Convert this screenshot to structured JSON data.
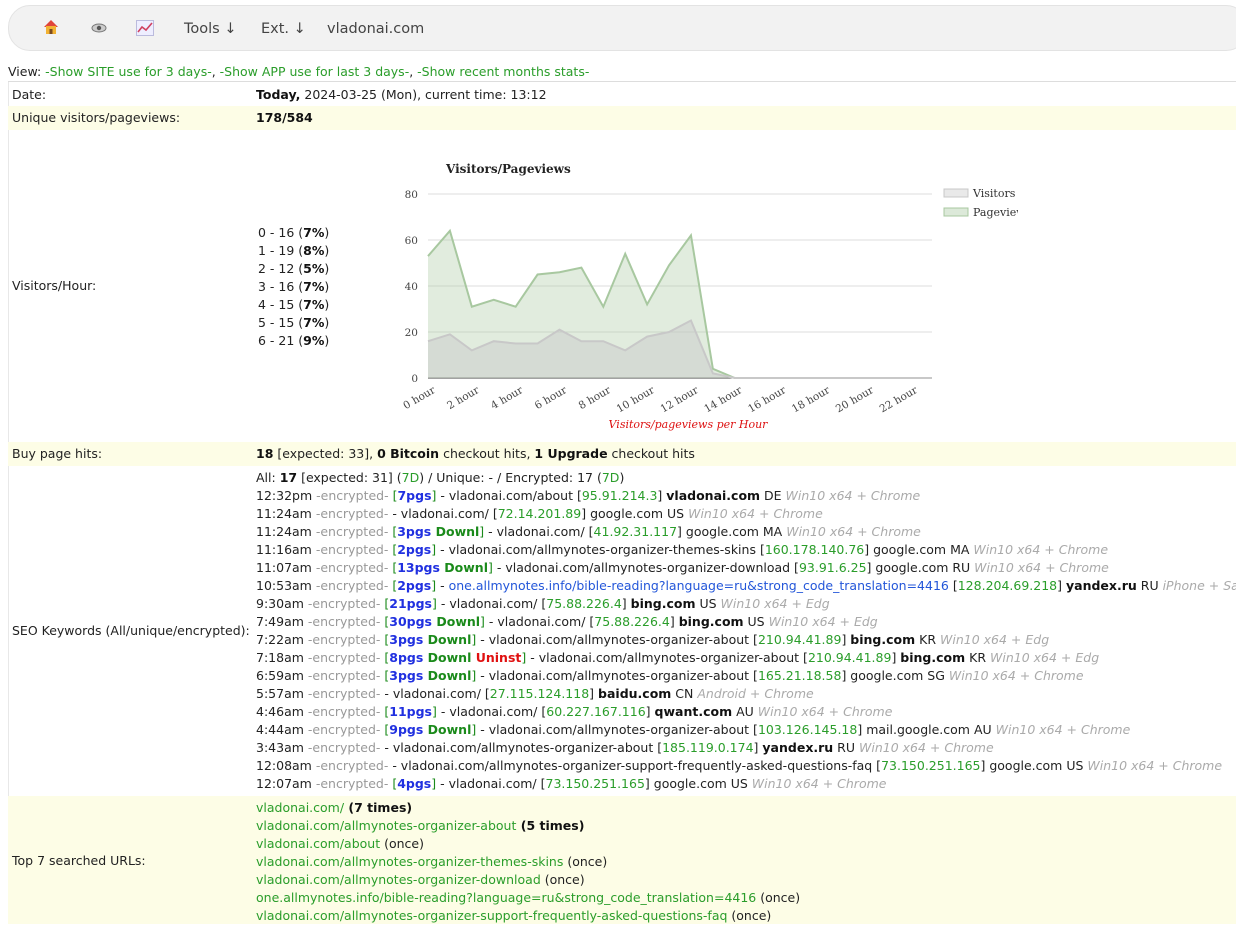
{
  "nav": {
    "home_icon": "home-icon",
    "eye_icon": "eye-icon",
    "chart_icon": "chart-icon",
    "tools": "Tools ↓",
    "ext": "Ext. ↓",
    "site": "vladonai.com"
  },
  "view": {
    "label": "View: ",
    "link1": "-Show SITE use for 3 days-",
    "sep1": ", ",
    "link2": "-Show APP use for last 3 days-",
    "sep2": ", ",
    "link3": "-Show recent months stats-"
  },
  "date": {
    "label": "Date:",
    "today": "Today,",
    "rest": " 2024-03-25 (Mon), current time: 13:12"
  },
  "unique": {
    "label": "Unique visitors/pageviews:",
    "value": "178/584"
  },
  "hours": {
    "label": "Visitors/Hour:",
    "items": [
      {
        "a": "0 - 16 (",
        "b": "7%",
        "c": ")"
      },
      {
        "a": "1 - 19 (",
        "b": "8%",
        "c": ")"
      },
      {
        "a": "2 - 12 (",
        "b": "5%",
        "c": ")"
      },
      {
        "a": "3 - 16 (",
        "b": "7%",
        "c": ")"
      },
      {
        "a": "4 - 15 (",
        "b": "7%",
        "c": ")"
      },
      {
        "a": "5 - 15 (",
        "b": "7%",
        "c": ")"
      },
      {
        "a": "6 - 21 (",
        "b": "9%",
        "c": ")"
      }
    ]
  },
  "chart_data": {
    "type": "area",
    "title": "Visitors/Pageviews",
    "xlabel": "Visitors/pageviews per Hour",
    "ylabel": "",
    "ylim": [
      0,
      80
    ],
    "yticks": [
      "0",
      "20",
      "40",
      "60",
      "80"
    ],
    "x": [
      0,
      1,
      2,
      3,
      4,
      5,
      6,
      7,
      8,
      9,
      10,
      11,
      12,
      13,
      14,
      15,
      16,
      17,
      18,
      19,
      20,
      21,
      22,
      23
    ],
    "xtick_labels": [
      "0 hour",
      "2 hour",
      "4 hour",
      "6 hour",
      "8 hour",
      "10 hour",
      "12 hour",
      "14 hour",
      "16 hour",
      "18 hour",
      "20 hour",
      "22 hour"
    ],
    "series": [
      {
        "name": "Visitors",
        "color": "#c8c8c8",
        "values": [
          16,
          19,
          12,
          16,
          15,
          15,
          21,
          16,
          16,
          12,
          18,
          20,
          25,
          2,
          0,
          0,
          0,
          0,
          0,
          0,
          0,
          0,
          0,
          0
        ]
      },
      {
        "name": "Pageviews",
        "color": "#a8c8a0",
        "values": [
          53,
          64,
          31,
          34,
          31,
          45,
          46,
          48,
          31,
          54,
          32,
          49,
          62,
          4,
          0,
          0,
          0,
          0,
          0,
          0,
          0,
          0,
          0,
          0
        ]
      }
    ],
    "legend": "top-right",
    "grid": true
  },
  "buy": {
    "label": "Buy page hits:",
    "n1": "18",
    "t1": " [expected: 33], ",
    "n2": "0 Bitcoin",
    "t2": " checkout hits, ",
    "n3": "1 Upgrade",
    "t3": " checkout hits"
  },
  "seo": {
    "label": "SEO Keywords (All/unique/encrypted):",
    "summary_a": "All: ",
    "summary_b": "17",
    "summary_c": " [expected: 31] (",
    "summary_d": "7D",
    "summary_e": ") / Unique: - / Encrypted: 17 (",
    "summary_f": "7D",
    "summary_g": ")",
    "entries": [
      {
        "time": "12:32pm",
        "enc": " -encrypted- ",
        "b1": "[",
        "pg": "7pgs",
        "dl": "",
        "un": "",
        "b2": "]",
        " url": "",
        "u": " - vladonai.com/about [",
        "ip": "95.91.214.3",
        "after": "] ",
        "eng": "vladonai.com",
        "engb": true,
        "cc": " DE ",
        "ua": "Win10 x64 + Chrome"
      },
      {
        "time": "11:24am",
        "enc": " -encrypted- ",
        "b1": "",
        "pg": "",
        "dl": "",
        "un": "",
        "b2": "",
        "u": " - vladonai.com/ [",
        "ip": "72.14.201.89",
        "after": "] ",
        "eng": "google.com",
        "engb": false,
        "cc": " US ",
        "ua": "Win10 x64 + Chrome"
      },
      {
        "time": "11:24am",
        "enc": " -encrypted- ",
        "b1": "[",
        "pg": "3pgs",
        "dl": " Downl",
        "un": "",
        "b2": "]",
        "u": " - vladonai.com/ [",
        "ip": "41.92.31.117",
        "after": "] ",
        "eng": "google.com",
        "engb": false,
        "cc": " MA ",
        "ua": "Win10 x64 + Chrome"
      },
      {
        "time": "11:16am",
        "enc": " -encrypted- ",
        "b1": "[",
        "pg": "2pgs",
        "dl": "",
        "un": "",
        "b2": "]",
        "u": " - vladonai.com/allmynotes-organizer-themes-skins [",
        "ip": "160.178.140.76",
        "after": "] ",
        "eng": "google.com",
        "engb": false,
        "cc": " MA ",
        "ua": "Win10 x64 + Chrome"
      },
      {
        "time": "11:07am",
        "enc": " -encrypted- ",
        "b1": "[",
        "pg": "13pgs",
        "dl": " Downl",
        "un": "",
        "b2": "]",
        "u": " - vladonai.com/allmynotes-organizer-download [",
        "ip": "93.91.6.25",
        "after": "] ",
        "eng": "google.com",
        "engb": false,
        "cc": " RU ",
        "ua": "Win10 x64 + Chrome"
      },
      {
        "time": "10:53am",
        "enc": " -encrypted- ",
        "b1": "[",
        "pg": "2pgs",
        "dl": "",
        "un": "",
        "b2": "]",
        "u": " - ",
        "link": "one.allmynotes.info/bible-reading?language=ru&strong_code_translation=4416",
        "u2": " [",
        "ip": "128.204.69.218",
        "after": "] ",
        "eng": "yandex.ru",
        "engb": true,
        "cc": " RU ",
        "ua": "iPhone + Safari"
      },
      {
        "time": "9:30am",
        "enc": " -encrypted- ",
        "b1": "[",
        "pg": "21pgs",
        "dl": "",
        "un": "",
        "b2": "]",
        "u": " - vladonai.com/ [",
        "ip": "75.88.226.4",
        "after": "] ",
        "eng": "bing.com",
        "engb": true,
        "cc": " US ",
        "ua": "Win10 x64 + Edg"
      },
      {
        "time": "7:49am",
        "enc": " -encrypted- ",
        "b1": "[",
        "pg": "30pgs",
        "dl": " Downl",
        "un": "",
        "b2": "]",
        "u": " - vladonai.com/ [",
        "ip": "75.88.226.4",
        "after": "] ",
        "eng": "bing.com",
        "engb": true,
        "cc": " US ",
        "ua": "Win10 x64 + Edg"
      },
      {
        "time": "7:22am",
        "enc": " -encrypted- ",
        "b1": "[",
        "pg": "3pgs",
        "dl": " Downl",
        "un": "",
        "b2": "]",
        "u": " - vladonai.com/allmynotes-organizer-about [",
        "ip": "210.94.41.89",
        "after": "] ",
        "eng": "bing.com",
        "engb": true,
        "cc": " KR ",
        "ua": "Win10 x64 + Edg"
      },
      {
        "time": "7:18am",
        "enc": " -encrypted- ",
        "b1": "[",
        "pg": "8pgs",
        "dl": " Downl",
        "un": " Uninst",
        "b2": "]",
        "u": " - vladonai.com/allmynotes-organizer-about [",
        "ip": "210.94.41.89",
        "after": "] ",
        "eng": "bing.com",
        "engb": true,
        "cc": " KR ",
        "ua": "Win10 x64 + Edg"
      },
      {
        "time": "6:59am",
        "enc": " -encrypted- ",
        "b1": "[",
        "pg": "3pgs",
        "dl": " Downl",
        "un": "",
        "b2": "]",
        "u": " - vladonai.com/allmynotes-organizer-about [",
        "ip": "165.21.18.58",
        "after": "] ",
        "eng": "google.com",
        "engb": false,
        "cc": " SG ",
        "ua": "Win10 x64 + Chrome"
      },
      {
        "time": "5:57am",
        "enc": " -encrypted- ",
        "b1": "",
        "pg": "",
        "dl": "",
        "un": "",
        "b2": "",
        "u": " - vladonai.com/ [",
        "ip": "27.115.124.118",
        "after": "] ",
        "eng": "baidu.com",
        "engb": true,
        "cc": " CN ",
        "ua": "Android + Chrome"
      },
      {
        "time": "4:46am",
        "enc": " -encrypted- ",
        "b1": "[",
        "pg": "11pgs",
        "dl": "",
        "un": "",
        "b2": "]",
        "u": " - vladonai.com/ [",
        "ip": "60.227.167.116",
        "after": "] ",
        "eng": "qwant.com",
        "engb": true,
        "cc": " AU ",
        "ua": "Win10 x64 + Chrome"
      },
      {
        "time": "4:44am",
        "enc": " -encrypted- ",
        "b1": "[",
        "pg": "9pgs",
        "dl": " Downl",
        "un": "",
        "b2": "]",
        "u": " - vladonai.com/allmynotes-organizer-about [",
        "ip": "103.126.145.18",
        "after": "] ",
        "eng": "mail.google.com",
        "engb": false,
        "cc": " AU ",
        "ua": "Win10 x64 + Chrome"
      },
      {
        "time": "3:43am",
        "enc": " -encrypted- ",
        "b1": "",
        "pg": "",
        "dl": "",
        "un": "",
        "b2": "",
        "u": " - vladonai.com/allmynotes-organizer-about [",
        "ip": "185.119.0.174",
        "after": "] ",
        "eng": "yandex.ru",
        "engb": true,
        "cc": " RU ",
        "ua": "Win10 x64 + Chrome"
      },
      {
        "time": "12:08am",
        "enc": " -encrypted- ",
        "b1": "",
        "pg": "",
        "dl": "",
        "un": "",
        "b2": "",
        "u": " - vladonai.com/allmynotes-organizer-support-frequently-asked-questions-faq [",
        "ip": "73.150.251.165",
        "after": "] ",
        "eng": "google.com",
        "engb": false,
        "cc": " US ",
        "ua": "Win10 x64 + Chrome"
      },
      {
        "time": "12:07am",
        "enc": " -encrypted- ",
        "b1": "[",
        "pg": "4pgs",
        "dl": "",
        "un": "",
        "b2": "]",
        "u": " - vladonai.com/ [",
        "ip": "73.150.251.165",
        "after": "] ",
        "eng": "google.com",
        "engb": false,
        "cc": " US ",
        "ua": "Win10 x64 + Chrome"
      }
    ]
  },
  "top": {
    "label": "Top 7 searched URLs:",
    "items": [
      {
        "url": "vladonai.com/",
        "count": " (7 times)",
        "bold": true
      },
      {
        "url": "vladonai.com/allmynotes-organizer-about",
        "count": " (5 times)",
        "bold": true
      },
      {
        "url": "vladonai.com/about",
        "count": " (once)",
        "bold": false
      },
      {
        "url": "vladonai.com/allmynotes-organizer-themes-skins",
        "count": " (once)",
        "bold": false
      },
      {
        "url": "vladonai.com/allmynotes-organizer-download",
        "count": " (once)",
        "bold": false
      },
      {
        "url": "one.allmynotes.info/bible-reading?language=ru&strong_code_translation=4416",
        "count": " (once)",
        "bold": false
      },
      {
        "url": "vladonai.com/allmynotes-organizer-support-frequently-asked-questions-faq",
        "count": " (once)",
        "bold": false
      }
    ]
  }
}
